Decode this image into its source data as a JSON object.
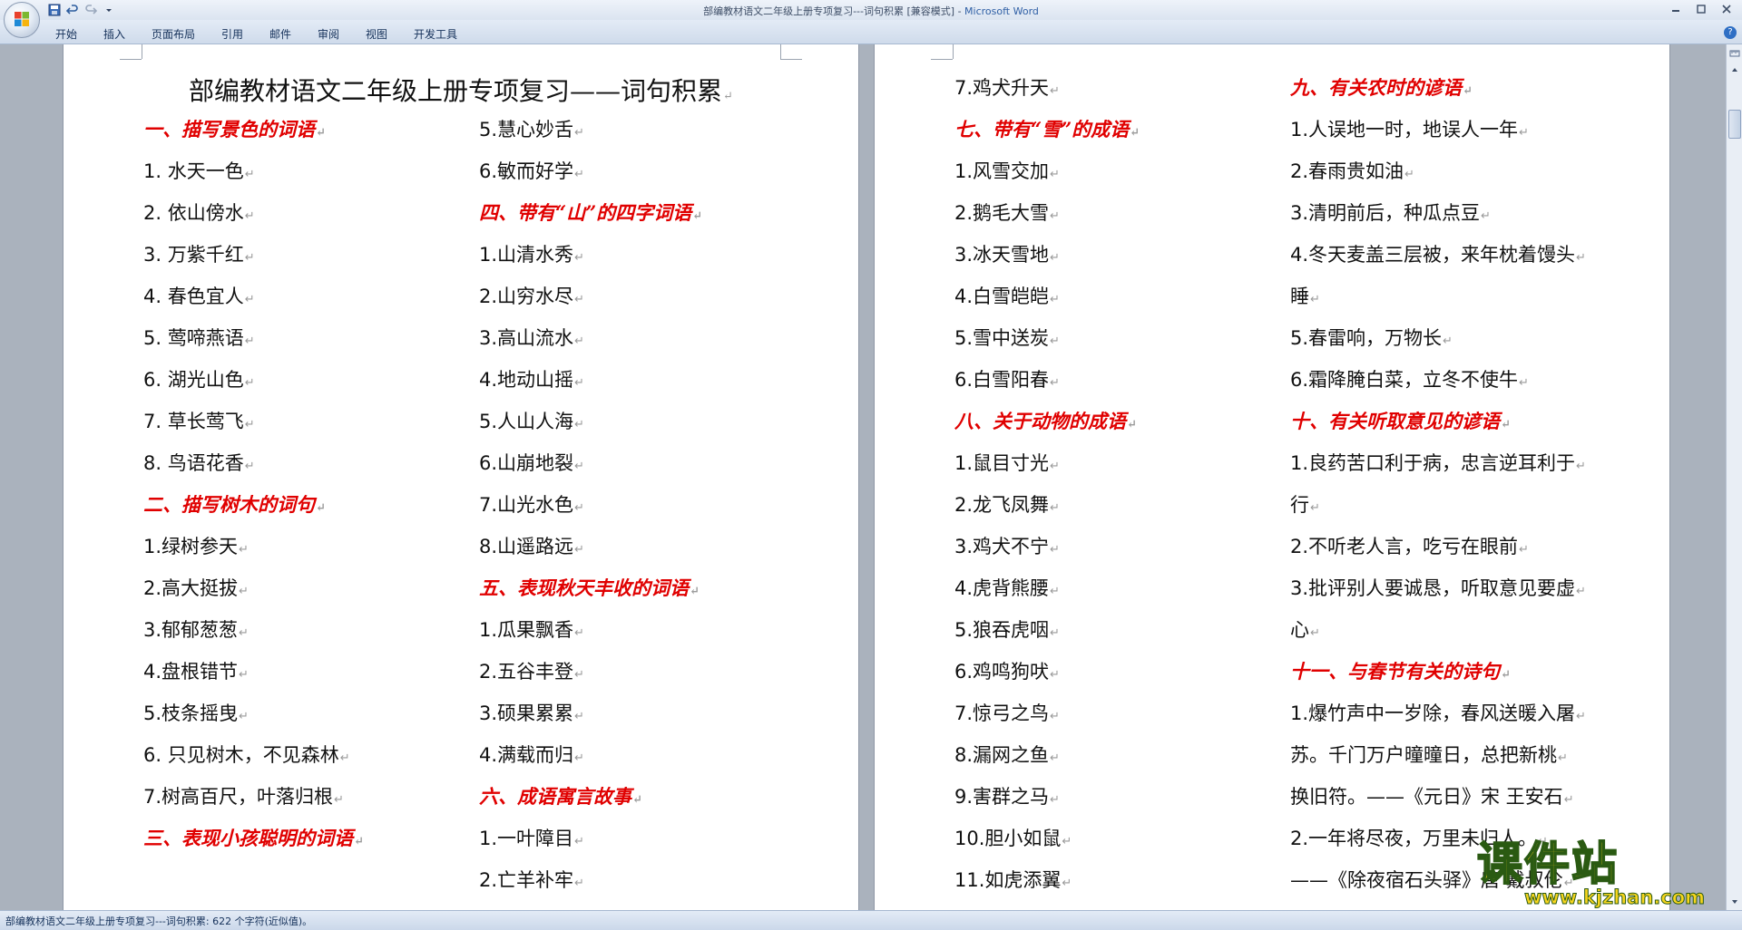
{
  "window": {
    "title_doc": "部编教材语文二年级上册专项复习---词句积累 [兼容模式] - ",
    "title_app": "Microsoft Word"
  },
  "ribbon": {
    "tabs": [
      "开始",
      "插入",
      "页面布局",
      "引用",
      "邮件",
      "审阅",
      "视图",
      "开发工具"
    ]
  },
  "icons": {
    "office_button": "office-logo-icon",
    "save": "save-icon",
    "undo": "undo-icon",
    "redo": "redo-icon",
    "customize": "chevron-down-icon",
    "help": "help-icon"
  },
  "colors": {
    "heading": "#e00000",
    "watermark": "#f7d51d"
  },
  "document": {
    "title": "部编教材语文二年级上册专项复习——词句积累",
    "page1": {
      "col1": [
        {
          "t": "一、描写景色的词语",
          "h": true
        },
        {
          "t": "1. 水天一色"
        },
        {
          "t": "2. 依山傍水"
        },
        {
          "t": "3. 万紫千红"
        },
        {
          "t": "4. 春色宜人"
        },
        {
          "t": "5. 莺啼燕语"
        },
        {
          "t": "6. 湖光山色"
        },
        {
          "t": "7.  草长莺飞"
        },
        {
          "t": "8.  鸟语花香"
        },
        {
          "t": "二、描写树木的词句",
          "h": true
        },
        {
          "t": "1.绿树参天"
        },
        {
          "t": "2.高大挺拔"
        },
        {
          "t": "3.郁郁葱葱"
        },
        {
          "t": "4.盘根错节"
        },
        {
          "t": "5.枝条摇曳"
        },
        {
          "t": "6. 只见树木，不见森林"
        },
        {
          "t": "7.树高百尺，叶落归根"
        },
        {
          "t": "三、表现小孩聪明的词语",
          "h": true
        }
      ],
      "col2": [
        {
          "t": "5.慧心妙舌"
        },
        {
          "t": "6.敏而好学"
        },
        {
          "t": "四、带有“山”的四字词语",
          "h": true
        },
        {
          "t": "1.山清水秀"
        },
        {
          "t": "2.山穷水尽"
        },
        {
          "t": "3.高山流水"
        },
        {
          "t": "4.地动山摇"
        },
        {
          "t": "5.人山人海"
        },
        {
          "t": "6.山崩地裂"
        },
        {
          "t": "7.山光水色"
        },
        {
          "t": "8.山遥路远"
        },
        {
          "t": "五、表现秋天丰收的词语",
          "h": true
        },
        {
          "t": "1.瓜果飘香"
        },
        {
          "t": "2.五谷丰登"
        },
        {
          "t": "3.硕果累累"
        },
        {
          "t": "4.满载而归"
        },
        {
          "t": "六、成语寓言故事",
          "h": true
        },
        {
          "t": "1.一叶障目"
        },
        {
          "t": "2.亡羊补牢"
        }
      ]
    },
    "page2": {
      "col1": [
        {
          "t": "7.鸡犬升天"
        },
        {
          "t": "七、带有“雪”的成语",
          "h": true
        },
        {
          "t": "1.风雪交加"
        },
        {
          "t": "2.鹅毛大雪"
        },
        {
          "t": "3.冰天雪地"
        },
        {
          "t": "4.白雪皑皑"
        },
        {
          "t": "5.雪中送炭"
        },
        {
          "t": "6.白雪阳春"
        },
        {
          "t": "八、关于动物的成语",
          "h": true
        },
        {
          "t": "1.鼠目寸光"
        },
        {
          "t": "2.龙飞凤舞"
        },
        {
          "t": "3.鸡犬不宁"
        },
        {
          "t": "4.虎背熊腰"
        },
        {
          "t": "5.狼吞虎咽"
        },
        {
          "t": "6.鸡鸣狗吠"
        },
        {
          "t": "7.惊弓之鸟"
        },
        {
          "t": "8.漏网之鱼"
        },
        {
          "t": "9.害群之马"
        },
        {
          "t": "10.胆小如鼠"
        },
        {
          "t": "11.如虎添翼"
        }
      ],
      "col2": [
        {
          "t": "九、有关农时的谚语",
          "h": true
        },
        {
          "t": "1.人误地一时，地误人一年"
        },
        {
          "t": "2.春雨贵如油"
        },
        {
          "t": "3.清明前后，种瓜点豆"
        },
        {
          "t": "4.冬天麦盖三层被，来年枕着馒头"
        },
        {
          "t": "睡"
        },
        {
          "t": "5.春雷响，万物长"
        },
        {
          "t": "6.霜降腌白菜，立冬不使牛"
        },
        {
          "t": "十、有关听取意见的谚语",
          "h": true
        },
        {
          "t": "1.良药苦口利于病，忠言逆耳利于"
        },
        {
          "t": "行"
        },
        {
          "t": "2.不听老人言，吃亏在眼前"
        },
        {
          "t": "3.批评别人要诚恳，听取意见要虚"
        },
        {
          "t": "心"
        },
        {
          "t": "十一、与春节有关的诗句",
          "h": true
        },
        {
          "t": "1.爆竹声中一岁除，春风送暖入屠"
        },
        {
          "t": "苏。千门万户曈曈日，总把新桃"
        },
        {
          "t": "换旧符。——《元日》宋  王安石"
        },
        {
          "t": "2.一年将尽夜，万里未归人。"
        },
        {
          "t": "——《除夜宿石头驿》唐 戴叔伦"
        }
      ]
    }
  },
  "status": {
    "text": "部编教材语文二年级上册专项复习---词句积累: 622 个字符(近似值)。"
  },
  "watermark": {
    "logo": "课件站",
    "url": "www.kjzhan.com"
  }
}
